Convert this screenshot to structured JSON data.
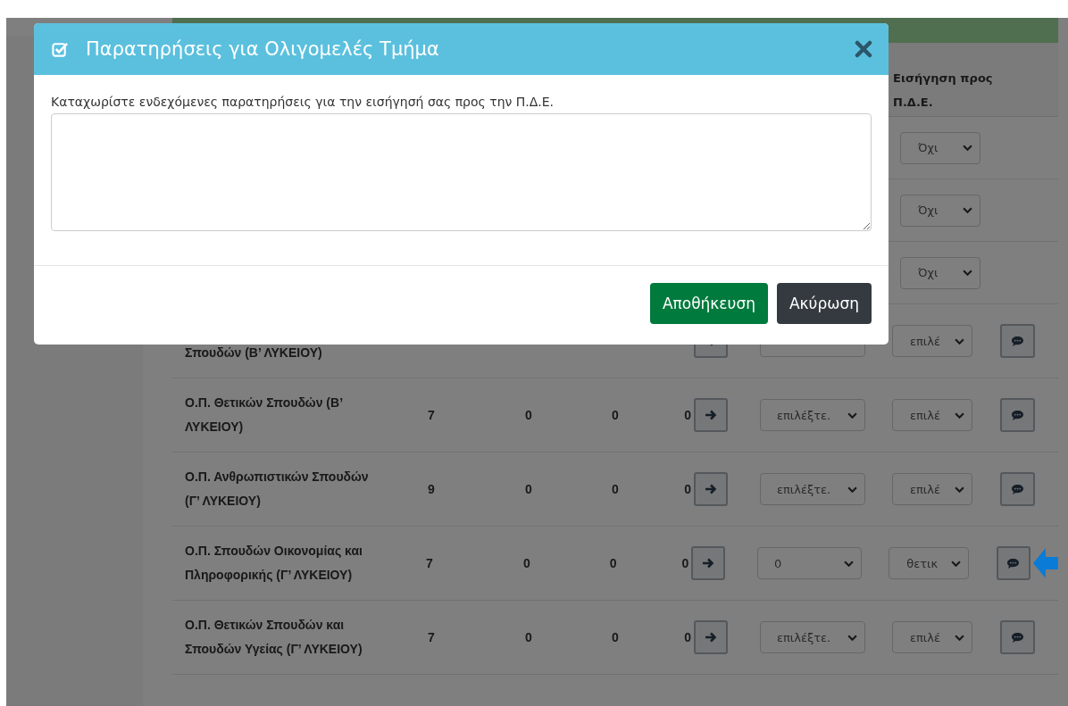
{
  "modal": {
    "title": "Παρατηρήσεις για Ολιγομελές Τμήμα",
    "label": "Καταχωρίστε ενδεχόμενες παρατηρήσεις για την εισήγησή σας προς την Π.Δ.Ε.",
    "buttons": [
      {
        "label": "Αποθήκευση",
        "kind": "primary"
      },
      {
        "label": "Ακύρωση",
        "kind": "secondary"
      }
    ]
  },
  "table": {
    "header": {
      "recommendation": "Εισήγηση προς Π.Δ.Ε."
    },
    "rows": [
      {
        "kind": "decided",
        "recommendation": "Όχι",
        "pointer": false
      },
      {
        "kind": "decided",
        "recommendation": "Όχι",
        "pointer": false
      },
      {
        "kind": "decided",
        "recommendation": "Όχι",
        "pointer": false
      },
      {
        "kind": "open",
        "name": "Σπουδών (Β’ ΛΥΚΕΙΟΥ)",
        "recommendation": "επιλέ",
        "pointer": false
      },
      {
        "kind": "open",
        "name": "Ο.Π. Θετικών Σπουδών (Β’ ΛΥΚΕΙΟΥ)",
        "values": [
          "7",
          "0",
          "0",
          "0"
        ],
        "placement": "επιλέξτε.",
        "recommendation": "επιλέ",
        "pointer": false
      },
      {
        "kind": "open",
        "name": "Ο.Π. Ανθρωπιστικών Σπουδών (Γ’ ΛΥΚΕΙΟΥ)",
        "values": [
          "9",
          "0",
          "0",
          "0"
        ],
        "placement": "επιλέξτε.",
        "recommendation": "επιλέ",
        "pointer": false
      },
      {
        "kind": "open",
        "name": "Ο.Π. Σπουδών Οικονομίας και Πληροφορικής (Γ’ ΛΥΚΕΙΟΥ)",
        "values": [
          "7",
          "0",
          "0",
          "0"
        ],
        "placement": "0",
        "recommendation": "θετικ",
        "pointer": true
      },
      {
        "kind": "open",
        "name": "Ο.Π. Θετικών Σπουδών και Σπουδών Υγείας (Γ’ ΛΥΚΕΙΟΥ)",
        "values": [
          "7",
          "0",
          "0",
          "0"
        ],
        "placement": "επιλέξτε.",
        "recommendation": "επιλέ",
        "pointer": false
      }
    ]
  }
}
